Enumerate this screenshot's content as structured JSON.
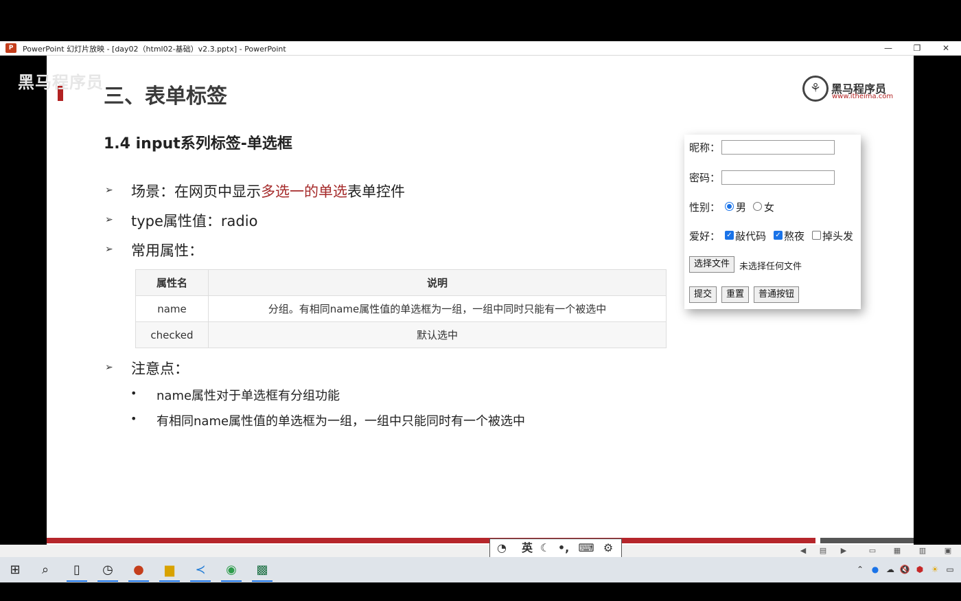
{
  "window": {
    "app_icon": "powerpoint-icon",
    "title": "PowerPoint 幻灯片放映 - [day02（html02-基础）v2.3.pptx] - PowerPoint",
    "controls": {
      "minimize": "—",
      "restore": "❐",
      "close": "✕"
    }
  },
  "slide": {
    "watermark": "黑马程序员 ",
    "heading": "三、表单标签",
    "logo": {
      "name": "黑马程序员",
      "url": "www.itheima.com"
    },
    "subheading": "1.4 input系列标签-单选框",
    "bullets": [
      {
        "marker": "➢",
        "prefix": "场景：在网页中显示",
        "highlight": "多选一的单选",
        "suffix": "表单控件"
      },
      {
        "marker": "➢",
        "text": "type属性值：radio"
      },
      {
        "marker": "➢",
        "text": "常用属性："
      }
    ],
    "table": {
      "headers": [
        "属性名",
        "说明"
      ],
      "rows": [
        [
          "name",
          "分组。有相同name属性值的单选框为一组，一组中同时只能有一个被选中"
        ],
        [
          "checked",
          "默认选中"
        ]
      ]
    },
    "notes_title": {
      "marker": "➢",
      "text": "注意点："
    },
    "notes": [
      {
        "marker": "•",
        "text": "name属性对于单选框有分组功能"
      },
      {
        "marker": "•",
        "text": "有相同name属性值的单选框为一组，一组中只能同时有一个被选中"
      }
    ]
  },
  "demo_form": {
    "nickname_label": "昵称：",
    "nickname_value": "",
    "password_label": "密码：",
    "password_value": "",
    "gender_label": "性别：",
    "gender_options": [
      {
        "label": "男",
        "checked": true
      },
      {
        "label": "女",
        "checked": false
      }
    ],
    "hobby_label": "爱好：",
    "hobby_options": [
      {
        "label": "敲代码",
        "checked": true
      },
      {
        "label": "熬夜",
        "checked": true
      },
      {
        "label": "掉头发",
        "checked": false
      }
    ],
    "file_button": "选择文件",
    "file_status": "未选择任何文件",
    "submit": "提交",
    "reset": "重置",
    "normal_button": "普通按钮"
  },
  "ime_bar": {
    "icons": [
      "ime-logo-icon",
      "moon-icon",
      "punctuation-icon",
      "keyboard-icon",
      "gear-icon"
    ],
    "mode": "英"
  },
  "taskbar": {
    "apps": [
      "windows-start-icon",
      "search-icon",
      "file-icon",
      "clock-app-icon",
      "powerpoint-icon",
      "file-explorer-icon",
      "vscode-icon",
      "chrome-icon",
      "excel-icon"
    ]
  },
  "colors": {
    "accent_red": "#b5262b",
    "highlight": "#a52a2a",
    "selection_blue": "#1a73e8"
  }
}
